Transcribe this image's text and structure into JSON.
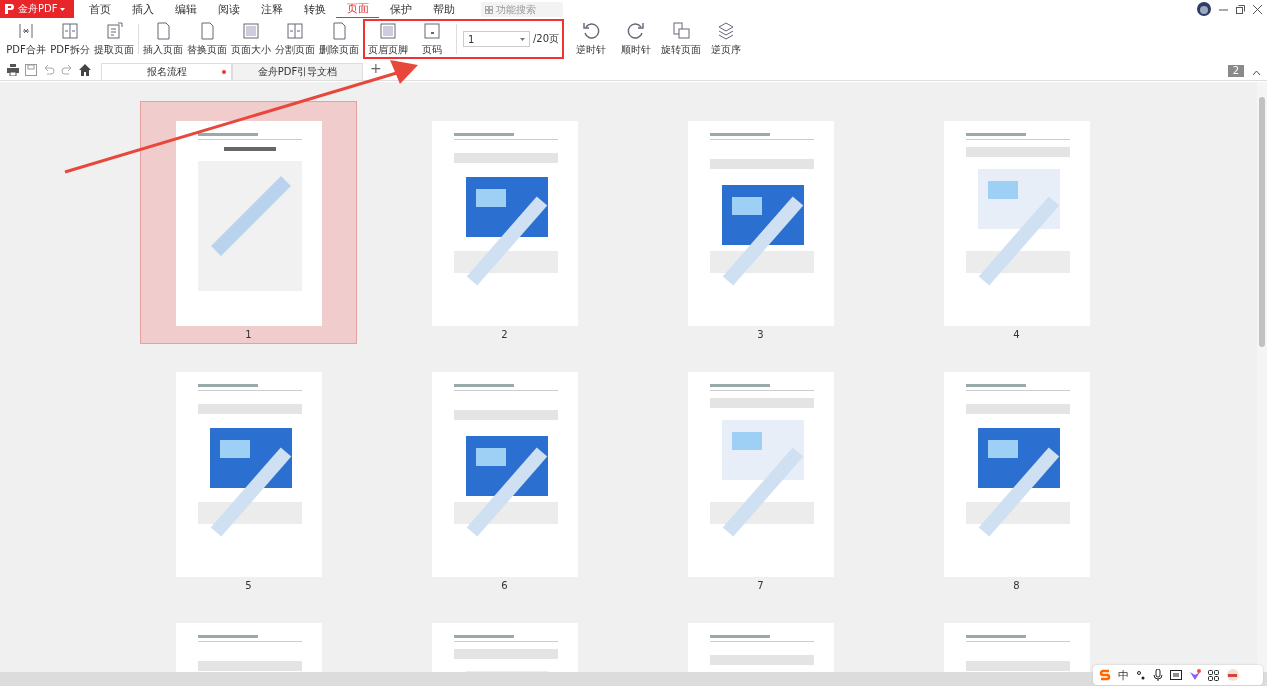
{
  "app": {
    "brand": "金舟PDF"
  },
  "menu": [
    {
      "label": "首页",
      "selected": false
    },
    {
      "label": "插入",
      "selected": false
    },
    {
      "label": "编辑",
      "selected": false
    },
    {
      "label": "阅读",
      "selected": false
    },
    {
      "label": "注释",
      "selected": false
    },
    {
      "label": "转换",
      "selected": false
    },
    {
      "label": "页面",
      "selected": true
    },
    {
      "label": "保护",
      "selected": false
    },
    {
      "label": "帮助",
      "selected": false
    }
  ],
  "search": {
    "placeholder": "功能搜索"
  },
  "toolbar": {
    "groups": [
      [
        {
          "label": "PDF合并"
        },
        {
          "label": "PDF拆分"
        },
        {
          "label": "提取页面"
        }
      ],
      [
        {
          "label": "插入页面"
        },
        {
          "label": "替换页面"
        },
        {
          "label": "页面大小"
        },
        {
          "label": "分割页面"
        },
        {
          "label": "删除页面"
        }
      ],
      [
        {
          "label": "页眉页脚"
        },
        {
          "label": "页码"
        }
      ]
    ],
    "page_select": {
      "value": "1",
      "total": "/20页"
    },
    "rotate": [
      {
        "label": "逆时针"
      },
      {
        "label": "顺时针"
      },
      {
        "label": "旋转页面"
      },
      {
        "label": "逆页序"
      }
    ]
  },
  "doc_tabs": [
    {
      "title": "报名流程",
      "selected": true,
      "modified": true
    },
    {
      "title": "金舟PDF引导文档",
      "selected": false,
      "modified": false
    }
  ],
  "new_tab": "+",
  "open_count": "2",
  "pages": [
    {
      "label": "1",
      "selected": true
    },
    {
      "label": "2",
      "selected": false
    },
    {
      "label": "3",
      "selected": false
    },
    {
      "label": "4",
      "selected": false
    },
    {
      "label": "5",
      "selected": false
    },
    {
      "label": "6",
      "selected": false
    },
    {
      "label": "7",
      "selected": false
    },
    {
      "label": "8",
      "selected": false
    },
    {
      "selected": false
    },
    {
      "selected": false
    },
    {
      "selected": false
    },
    {
      "selected": false
    }
  ],
  "ime": {
    "mode": "中"
  }
}
